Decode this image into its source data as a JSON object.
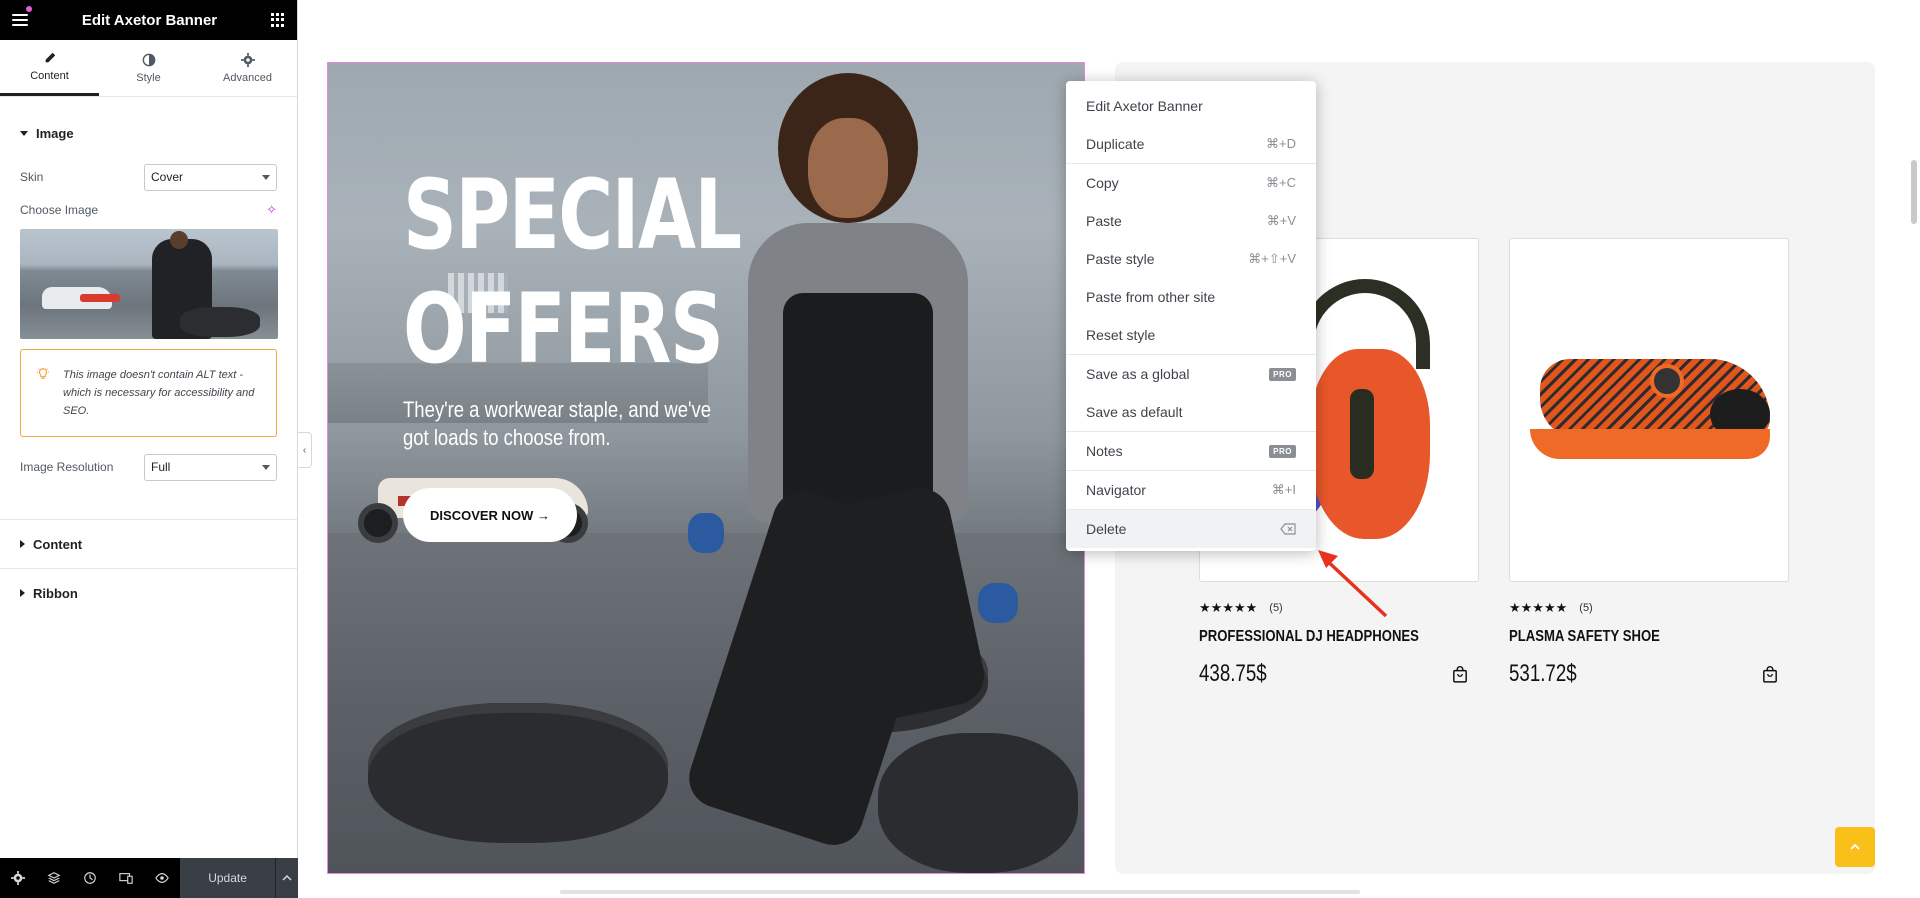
{
  "panel": {
    "title": "Edit Axetor Banner",
    "tabs": [
      {
        "label": "Content",
        "icon": "pencil-icon"
      },
      {
        "label": "Style",
        "icon": "contrast-icon"
      },
      {
        "label": "Advanced",
        "icon": "gear-icon"
      }
    ],
    "image_section": {
      "title": "Image",
      "skin_label": "Skin",
      "skin_value": "Cover",
      "choose_image_label": "Choose Image",
      "alt_warning": "This image doesn't contain ALT text - which is necessary for accessibility and SEO.",
      "resolution_label": "Image Resolution",
      "resolution_value": "Full"
    },
    "collapsed_sections": [
      "Content",
      "Ribbon"
    ],
    "footer": {
      "update_label": "Update"
    }
  },
  "banner": {
    "title_line1": "SPECIAL",
    "title_line2": "OFFERS",
    "subtitle": "They're a workwear staple, and we've got loads to choose from.",
    "button_label": "DISCOVER NOW →"
  },
  "products": [
    {
      "name": "PROFESSIONAL DJ HEADPHONES",
      "stars": "★★★★★",
      "rating_count": "(5)",
      "price": "438.75$"
    },
    {
      "name": "PLASMA SAFETY SHOE",
      "stars": "★★★★★",
      "rating_count": "(5)",
      "price": "531.72$"
    }
  ],
  "context_menu": {
    "items": [
      {
        "label": "Edit Axetor Banner",
        "shortcut": ""
      },
      {
        "label": "Duplicate",
        "shortcut": "⌘+D"
      },
      {
        "label": "Copy",
        "shortcut": "⌘+C"
      },
      {
        "label": "Paste",
        "shortcut": "⌘+V"
      },
      {
        "label": "Paste style",
        "shortcut": "⌘+⇧+V"
      },
      {
        "label": "Paste from other site",
        "shortcut": ""
      },
      {
        "label": "Reset style",
        "shortcut": ""
      },
      {
        "label": "Save as a global",
        "badge": "PRO"
      },
      {
        "label": "Save as default",
        "shortcut": ""
      },
      {
        "label": "Notes",
        "badge": "PRO"
      },
      {
        "label": "Navigator",
        "shortcut": "⌘+I"
      },
      {
        "label": "Delete",
        "icon": "delete-key-icon"
      }
    ]
  },
  "colors": {
    "accent_pink": "#e688d9",
    "warning_orange": "#f3a641",
    "scroll_top_yellow": "#f8c019",
    "arrow_red": "#e8321e"
  }
}
